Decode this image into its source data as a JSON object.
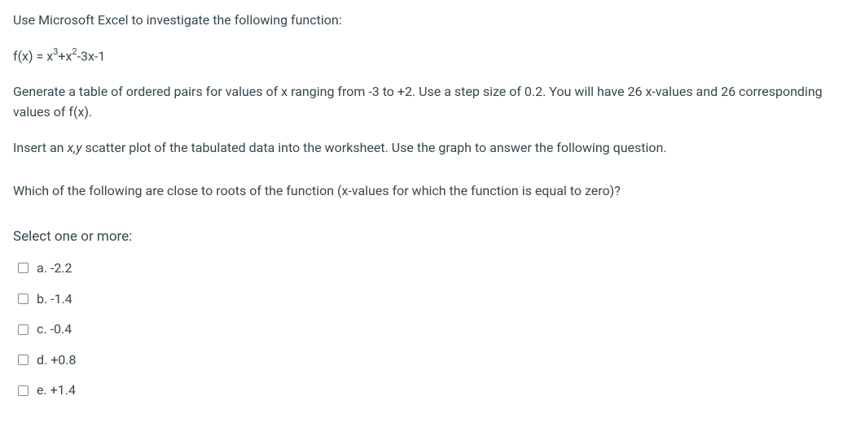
{
  "paragraphs": {
    "intro": "Use Microsoft Excel to investigate the following function:",
    "table_instruction": "Generate a table of ordered pairs for values of x ranging from -3 to +2. Use a step size of 0.2. You will have 26 x-values and 26 corresponding values of f(x).",
    "plot_prefix": "Insert an ",
    "plot_italic": "x,y",
    "plot_suffix": " scatter plot of the tabulated data into the worksheet. Use the graph to answer the following question.",
    "question": "Which of the following are close to roots of the function (x-values for which the function is equal to zero)?"
  },
  "formula": {
    "lhs": "f(x) = x",
    "exp1": "3",
    "mid1": "+x",
    "exp2": "2",
    "rhs": "-3x-1"
  },
  "select_prompt": "Select one or more:",
  "options": [
    {
      "label": "a. -2.2"
    },
    {
      "label": "b. -1.4"
    },
    {
      "label": "c. -0.4"
    },
    {
      "label": "d. +0.8"
    },
    {
      "label": "e. +1.4"
    }
  ]
}
